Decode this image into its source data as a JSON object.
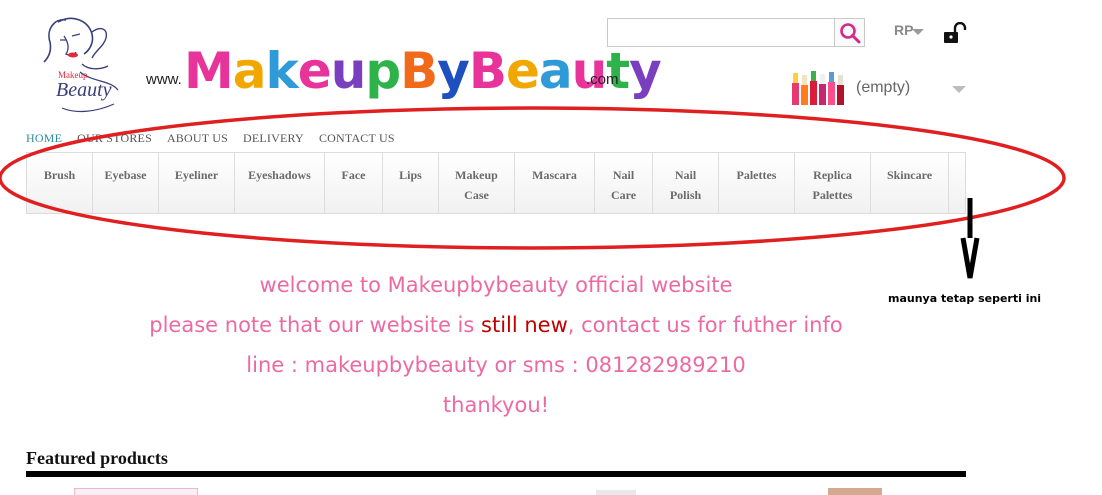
{
  "header": {
    "www": "www.",
    "brand_letters": [
      {
        "ch": "M",
        "color": "#e8339a"
      },
      {
        "ch": "a",
        "color": "#f0a800"
      },
      {
        "ch": "k",
        "color": "#2e9ad8"
      },
      {
        "ch": "e",
        "color": "#e8339a"
      },
      {
        "ch": "u",
        "color": "#7a3fbf"
      },
      {
        "ch": "p",
        "color": "#2eb24a"
      },
      {
        "ch": "B",
        "color": "#f06a1a"
      },
      {
        "ch": "y",
        "color": "#1d4fbf"
      },
      {
        "ch": "B",
        "color": "#e8339a"
      },
      {
        "ch": "e",
        "color": "#f0a800"
      },
      {
        "ch": "a",
        "color": "#2e9ad8"
      },
      {
        "ch": "u",
        "color": "#e8339a"
      },
      {
        "ch": "t",
        "color": "#2eb24a"
      },
      {
        "ch": "y",
        "color": "#7a3fbf"
      }
    ],
    "dotcom": ".com",
    "search": {
      "value": "",
      "placeholder": ""
    },
    "currency": "RP",
    "cart_label": "(empty)"
  },
  "top_nav": [
    {
      "label": "HOME",
      "active": true
    },
    {
      "label": "OUR STORES",
      "active": false
    },
    {
      "label": "ABOUT US",
      "active": false
    },
    {
      "label": "DELIVERY",
      "active": false
    },
    {
      "label": "CONTACT US",
      "active": false
    }
  ],
  "categories": [
    {
      "label": "Brush",
      "slug": "brush"
    },
    {
      "label": "Eyebase",
      "slug": "eyebase"
    },
    {
      "label": "Eyeliner",
      "slug": "eyeliner"
    },
    {
      "label": "Eyeshadows",
      "slug": "eyeshadows"
    },
    {
      "label": "Face",
      "slug": "face"
    },
    {
      "label": "Lips",
      "slug": "lips"
    },
    {
      "label": "Makeup\nCase",
      "slug": "makeup-case"
    },
    {
      "label": "Mascara",
      "slug": "mascara"
    },
    {
      "label": "Nail\nCare",
      "slug": "nail-care"
    },
    {
      "label": "Nail\nPolish",
      "slug": "nail-polish"
    },
    {
      "label": "Palettes",
      "slug": "palettes"
    },
    {
      "label": "Replica\nPalettes",
      "slug": "replica-palettes"
    },
    {
      "label": "Skincare",
      "slug": "skincare"
    }
  ],
  "annotation": {
    "note": "maunya tetap seperti ini",
    "ellipse_color": "#e02020"
  },
  "welcome": {
    "line1": "welcome to Makeupbybeauty official website",
    "line2_pre": "please note that our website is ",
    "line2_red": "still new",
    "line2_post": ", contact us for futher info",
    "line3": "line : makeupbybeauty or sms : 081282989210",
    "line4": "thankyou!"
  },
  "featured": {
    "title": "Featured products"
  },
  "colors": {
    "accent_link": "#2e8d9c",
    "welcome_pink": "#ec6aa3",
    "highlight_red": "#c00000"
  }
}
